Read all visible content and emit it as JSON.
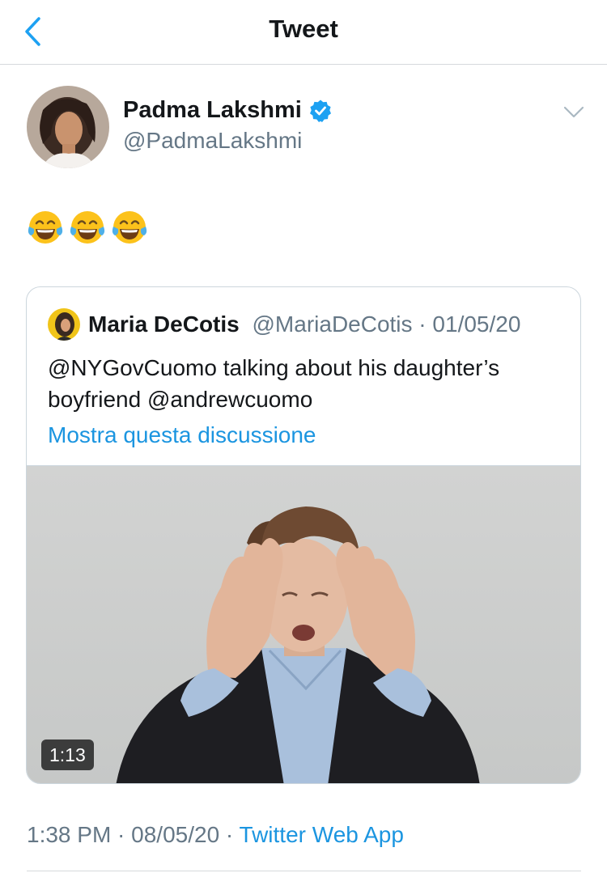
{
  "header": {
    "title": "Tweet"
  },
  "tweet": {
    "author_name": "Padma Lakshmi",
    "author_handle": "@PadmaLakshmi",
    "text": "😂😂😂",
    "timestamp": "1:38 PM · 08/05/20 · ",
    "source": "Twitter Web App"
  },
  "quoted": {
    "author_name": "Maria DeCotis",
    "author_handle": "@MariaDeCotis",
    "date_sep": " · ",
    "date": "01/05/20",
    "text": "@NYGovCuomo talking about his daughter’s boyfriend @andrewcuomo",
    "show_thread": "Mostra questa discussione",
    "video_duration": "1:13"
  },
  "colors": {
    "accent": "#1b95e0",
    "verified": "#1da1f2",
    "secondary_text": "#657786",
    "border": "#ccd6dd"
  },
  "icons": {
    "back": "chevron-left-icon",
    "verified": "verified-badge-icon",
    "more": "chevron-down-icon",
    "emoji": "face-with-tears-of-joy-icon"
  }
}
